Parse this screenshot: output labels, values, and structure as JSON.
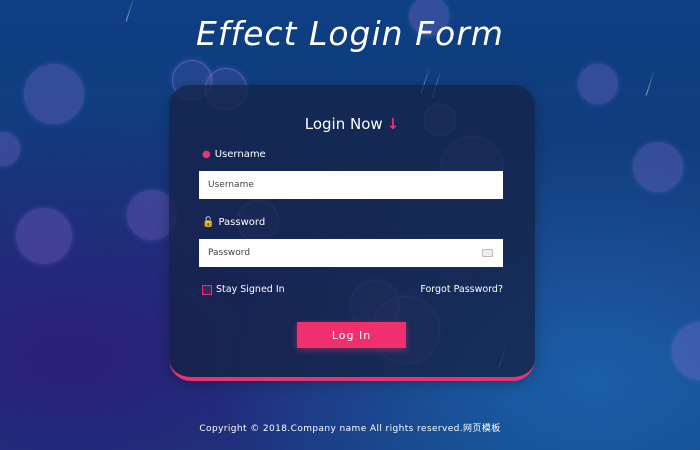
{
  "page": {
    "title": "Effect Login Form",
    "footer": "Copyright © 2018.Company name All rights reserved.网页模板"
  },
  "form": {
    "heading": "Login Now",
    "heading_icon": "arrow-down-icon",
    "username": {
      "label": "Username",
      "icon": "user-icon",
      "placeholder": "Username",
      "value": ""
    },
    "password": {
      "label": "Password",
      "icon": "lock-icon",
      "placeholder": "Password",
      "value": ""
    },
    "stay_signed_in": {
      "label": "Stay Signed In",
      "checked": false
    },
    "forgot_label": "Forgot Password?",
    "submit_label": "Log In"
  },
  "colors": {
    "accent": "#f0306e",
    "background_top": "#0d3f82",
    "card": "#142346"
  }
}
